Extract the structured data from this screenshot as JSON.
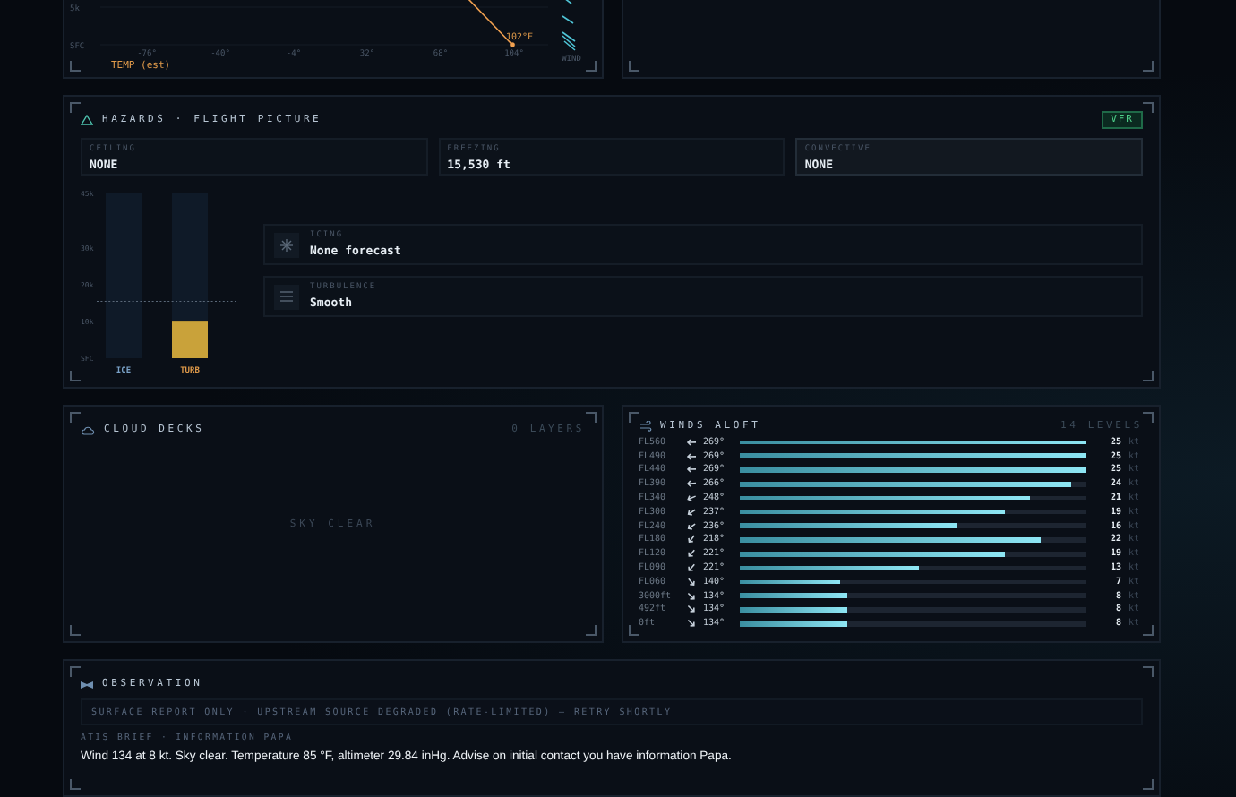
{
  "profile_chart": {
    "x_title": "TEMP (est)",
    "x_labels": [
      "-76°",
      "-40°",
      "-4°",
      "32°",
      "68°",
      "104°"
    ],
    "point_label": "102°F",
    "y_labels": [
      "5k",
      "SFC"
    ],
    "wind_label": "WIND"
  },
  "hazards": {
    "title": "HAZARDS · FLIGHT PICTURE",
    "badge": "VFR",
    "cells": [
      {
        "label": "CEILING",
        "value": "NONE",
        "highlighted": false
      },
      {
        "label": "FREEZING",
        "value": "15,530 ft",
        "highlighted": false
      },
      {
        "label": "CONVECTIVE",
        "value": "NONE",
        "highlighted": true
      }
    ],
    "chart_data": {
      "type": "bar",
      "categories": [
        "ICE",
        "TURB"
      ],
      "stacked": true,
      "series": [
        {
          "color": "#c9a23a",
          "values": [
            0,
            10000
          ]
        },
        {
          "color": "#0f1a28",
          "values": [
            45000,
            35000
          ]
        }
      ],
      "ylim": [
        0,
        45000
      ],
      "yticks": [
        {
          "value": 0,
          "label": "SFC"
        },
        {
          "value": 10000,
          "label": "10k"
        },
        {
          "value": 20000,
          "label": "20k"
        },
        {
          "value": 30000,
          "label": "30k"
        },
        {
          "value": 45000,
          "label": "45k"
        }
      ],
      "ref_lines": [
        {
          "axis": "y",
          "value": 15530
        }
      ]
    },
    "cards": [
      {
        "kind": "icing",
        "label": "ICING",
        "value": "None forecast"
      },
      {
        "kind": "turbulence",
        "label": "TURBULENCE",
        "value": "Smooth"
      }
    ]
  },
  "cloud_decks": {
    "title": "CLOUD DECKS",
    "count": "0 LAYERS",
    "empty": "SKY CLEAR"
  },
  "winds_aloft": {
    "title": "WINDS ALOFT",
    "count": "14 LEVELS",
    "rows": [
      {
        "level_name": "FL560",
        "direction": "269°",
        "speed": "25",
        "unit": "kt",
        "level": 1
      },
      {
        "level_name": "FL490",
        "direction": "269°",
        "speed": "25",
        "unit": "kt",
        "level": 1
      },
      {
        "level_name": "FL440",
        "direction": "269°",
        "speed": "25",
        "unit": "kt",
        "level": 1
      },
      {
        "level_name": "FL390",
        "direction": "266°",
        "speed": "24",
        "unit": "kt",
        "level": 0.96
      },
      {
        "level_name": "FL340",
        "direction": "248°",
        "speed": "21",
        "unit": "kt",
        "level": 0.84
      },
      {
        "level_name": "FL300",
        "direction": "237°",
        "speed": "19",
        "unit": "kt",
        "level": 0.77
      },
      {
        "level_name": "FL240",
        "direction": "236°",
        "speed": "16",
        "unit": "kt",
        "level": 0.63
      },
      {
        "level_name": "FL180",
        "direction": "218°",
        "speed": "22",
        "unit": "kt",
        "level": 0.87
      },
      {
        "level_name": "FL120",
        "direction": "221°",
        "speed": "19",
        "unit": "kt",
        "level": 0.77
      },
      {
        "level_name": "FL090",
        "direction": "221°",
        "speed": "13",
        "unit": "kt",
        "level": 0.52
      },
      {
        "level_name": "FL060",
        "direction": "140°",
        "speed": "7",
        "unit": "kt",
        "level": 0.29
      },
      {
        "level_name": "3000ft",
        "direction": "134°",
        "speed": "8",
        "unit": "kt",
        "level": 0.315
      },
      {
        "level_name": "492ft",
        "direction": "134°",
        "speed": "8",
        "unit": "kt",
        "level": 0.315
      },
      {
        "level_name": "0ft",
        "direction": "134°",
        "speed": "8",
        "unit": "kt",
        "level": 0.315
      }
    ]
  },
  "observation": {
    "title": "OBSERVATION",
    "banner": "SURFACE REPORT ONLY · UPSTREAM SOURCE DEGRADED (RATE-LIMITED) — RETRY SHORTLY",
    "brief_label": "ATIS BRIEF · INFORMATION PAPA",
    "text": "Wind 134 at 8 kt. Sky clear. Temperature 85 °F, altimeter 29.84 inHg. Advise on initial contact you have information Papa."
  }
}
